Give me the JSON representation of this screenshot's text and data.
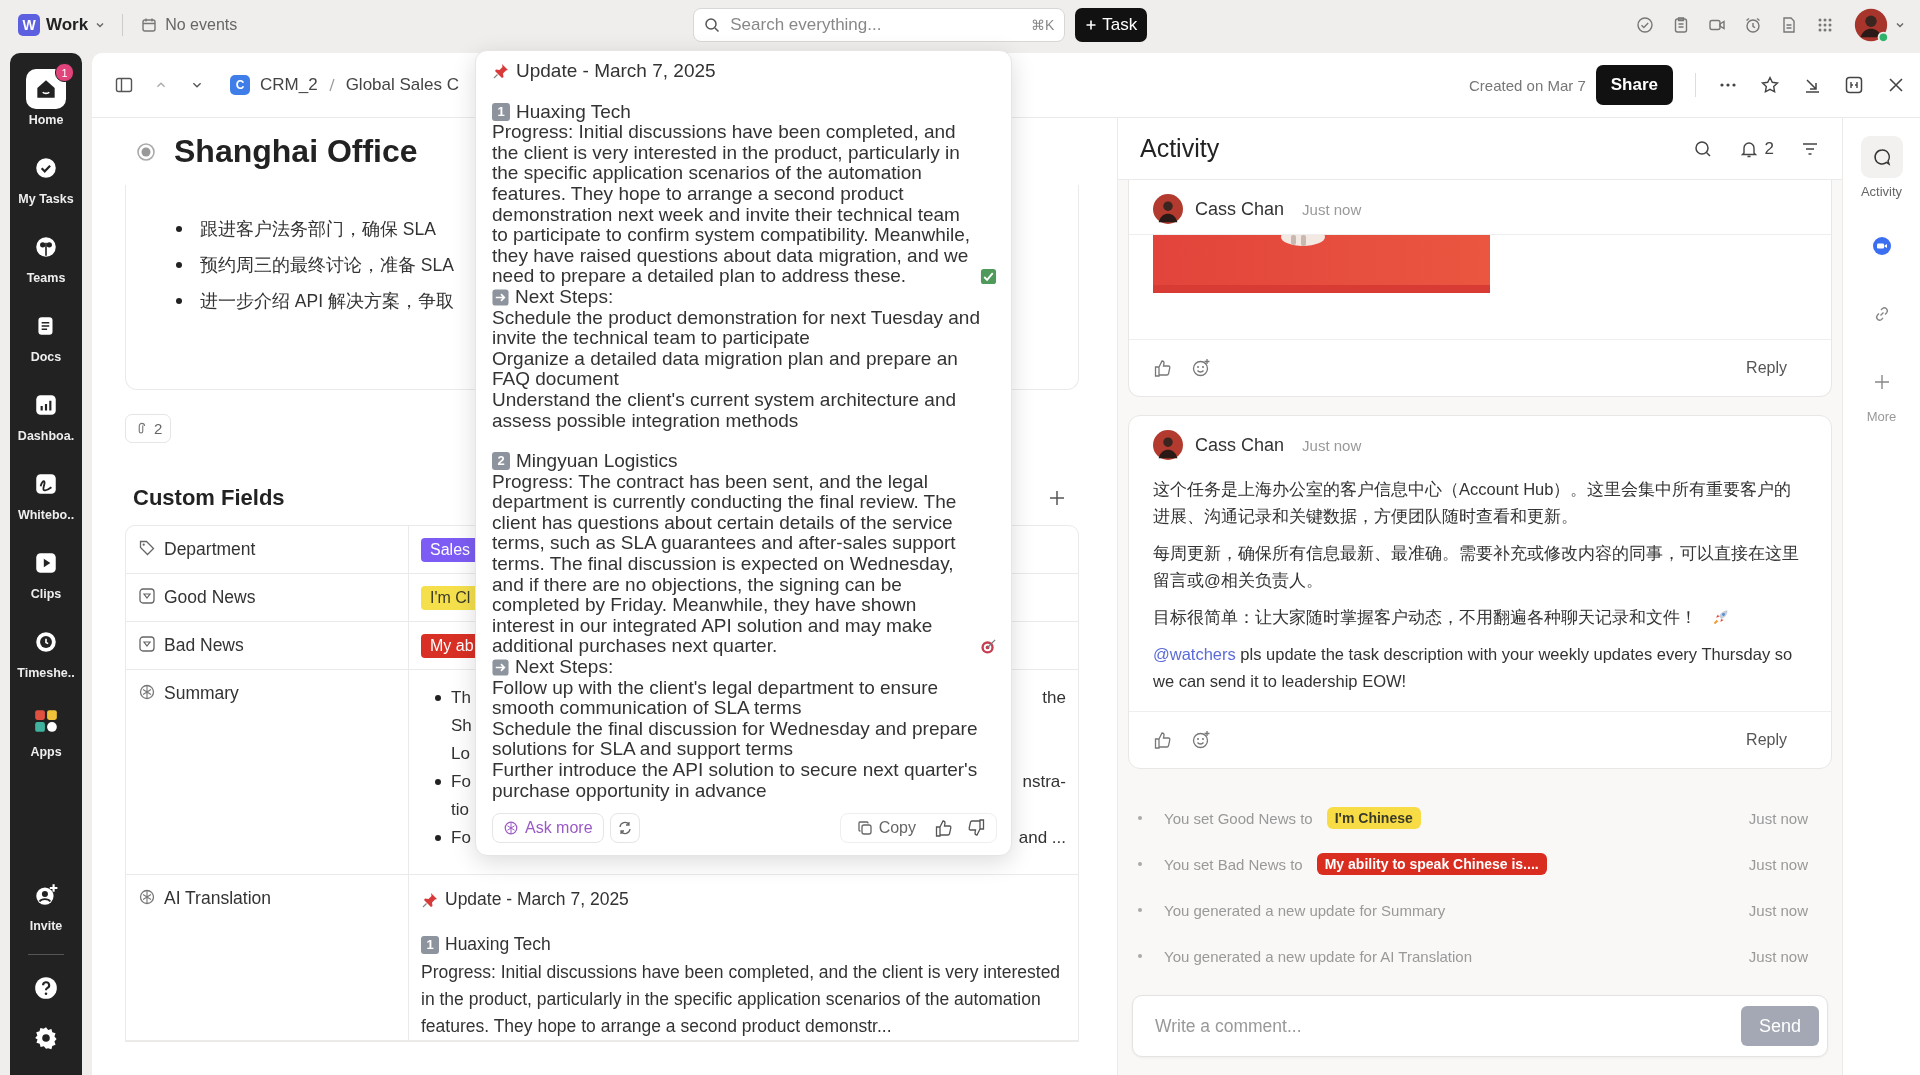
{
  "topbar": {
    "workspace_badge": "W",
    "workspace": "Work",
    "calendar": "No events",
    "search": {
      "placeholder": "Search everything...",
      "shortcut": "⌘K"
    },
    "new_task": "Task"
  },
  "nav": {
    "items": [
      {
        "kind": "home",
        "label": "Home",
        "selected": true,
        "badge": "1"
      },
      {
        "kind": "tasks",
        "label": "My Tasks",
        "selected": false
      },
      {
        "kind": "teams",
        "label": "Teams",
        "selected": false
      },
      {
        "kind": "docs",
        "label": "Docs",
        "selected": false
      },
      {
        "kind": "dashboards",
        "label": "Dashboa.",
        "selected": false
      },
      {
        "kind": "whiteboards",
        "label": "Whitebo..",
        "selected": false
      },
      {
        "kind": "clips",
        "label": "Clips",
        "selected": false
      },
      {
        "kind": "timesheets",
        "label": "Timeshe..",
        "selected": false
      },
      {
        "kind": "apps",
        "label": "Apps",
        "selected": false
      }
    ],
    "invite": "Invite"
  },
  "header": {
    "space_badge": "C",
    "breadcrumb": [
      "CRM_2",
      "Global Sales C"
    ],
    "created": "Created on Mar 7",
    "share": "Share"
  },
  "task": {
    "title": "Shanghai Office",
    "bullets": [
      "跟进客户法务部门，确保 SLA",
      "预约周三的最终讨论，准备 SLA",
      "进一步介绍 API 解决方案，争取"
    ],
    "attachments": "2"
  },
  "custom_fields": {
    "title": "Custom Fields",
    "rows": [
      {
        "kind": "label",
        "label": "Department",
        "tag": {
          "text": "Sales",
          "color": "#7c5cf4"
        }
      },
      {
        "kind": "dropdown",
        "label": "Good News",
        "tag": {
          "text": "I'm Cl",
          "color": "#f5e04c"
        }
      },
      {
        "kind": "dropdown",
        "label": "Bad News",
        "tag": {
          "text": "My ab",
          "color": "#d93025"
        }
      },
      {
        "kind": "summary",
        "label": "Summary",
        "lines": [
          {
            "bullet": true,
            "left": "Th",
            "right": "the"
          },
          {
            "bullet": false,
            "left": "Sh"
          },
          {
            "bullet": false,
            "left": "Lo"
          },
          {
            "bullet": true,
            "left": "Fo",
            "right": "nstra-"
          },
          {
            "bullet": false,
            "left": "tio"
          },
          {
            "bullet": true,
            "left": "Fo",
            "right": "and ..."
          }
        ]
      },
      {
        "kind": "translation",
        "label": "AI Translation",
        "title": "Update - March 7, 2025",
        "number": "1",
        "heading": "Huaxing Tech",
        "body": "Progress: Initial discussions have been completed, and the client is very interested in the product, particularly in the specific application scenarios of the automation features. They hope to arrange a second product demonstr..."
      }
    ]
  },
  "popup": {
    "title": "Update - March 7, 2025",
    "sections": [
      {
        "number": "1",
        "heading": "Huaxing Tech",
        "progress": "Progress: Initial discussions have been completed, and the client is very interested in the product, particularly in the specific application scenarios of the automation features. They hope to arrange a second product demonstration next week and invite their technical team to participate to confirm system compatibility. Meanwhile, they have raised questions about data migration, and we need to prepare a detailed plan to address these.",
        "kind": "check",
        "next_label": "Next Steps:",
        "steps": [
          "Schedule the product demonstration for next Tuesday and invite the technical team to participate",
          "Organize a detailed data migration plan and prepare an FAQ document",
          "Understand the client's current system architecture and assess possible integration methods"
        ]
      },
      {
        "number": "2",
        "heading": "Mingyuan Logistics",
        "progress": "Progress: The contract has been sent, and the legal department is currently conducting the final review. The client has questions about certain details of the service terms, such as SLA guarantees and after-sales support terms. The final discussion is expected on Wednesday, and if there are no objections, the signing can be completed by Friday. Meanwhile, they have shown interest in our integrated API solution and may make additional purchases next quarter.",
        "kind": "target",
        "next_label": "Next Steps:",
        "steps": [
          "Follow up with the client's legal department to ensure smooth communication of SLA terms",
          "Schedule the final discussion for Wednesday and prepare solutions for SLA and support terms",
          "Further introduce the API solution to secure next quarter's purchase opportunity in advance"
        ]
      }
    ],
    "ask_more": "Ask more",
    "copy": "Copy"
  },
  "activity": {
    "title": "Activity",
    "notifications": "2",
    "comments": [
      {
        "author": "Cass Chan",
        "time": "Just now",
        "reply": "Reply"
      },
      {
        "kind": "text",
        "author": "Cass Chan",
        "time": "Just now",
        "paragraphs": [
          {
            "text": "这个任务是上海办公室的客户信息中心（Account Hub）。这里会集中所有重要客户的进展、沟通记录和关键数据，方便团队随时查看和更新。",
            "rocket": false
          },
          {
            "text": "每周更新，确保所有信息最新、最准确。需要补充或修改内容的同事，可以直接在这里留言或@相关负责人。",
            "rocket": false
          },
          {
            "text": "目标很简单：让大家随时掌握客户动态，不用翻遍各种聊天记录和文件！",
            "rocket": true
          }
        ],
        "mention": "@watchers",
        "mention_text": "pls update the task description with your weekly updates every Thursday so we can send it to leadership EOW!",
        "reply": "Reply"
      }
    ],
    "events": [
      {
        "text": "You set Good News to",
        "tag": {
          "text": "I'm Chinese",
          "color": "#f7dc45"
        },
        "time": "Just now"
      },
      {
        "text": "You set Bad News to",
        "tag": {
          "text": "My ability to speak Chinese is....",
          "color": "#d92d20"
        },
        "time": "Just now"
      },
      {
        "text": "You generated a new update for Summary",
        "time": "Just now"
      },
      {
        "text": "You generated a new update for AI Translation",
        "time": "Just now"
      }
    ],
    "comment": {
      "placeholder": "Write a comment...",
      "send": "Send",
      "send_disabled": true
    }
  },
  "rail": [
    {
      "kind": "activity",
      "label": "Activity",
      "selected": true
    },
    {
      "kind": "app",
      "selected": false
    },
    {
      "kind": "link",
      "selected": false
    },
    {
      "kind": "add",
      "label": "More",
      "selected": false
    }
  ]
}
